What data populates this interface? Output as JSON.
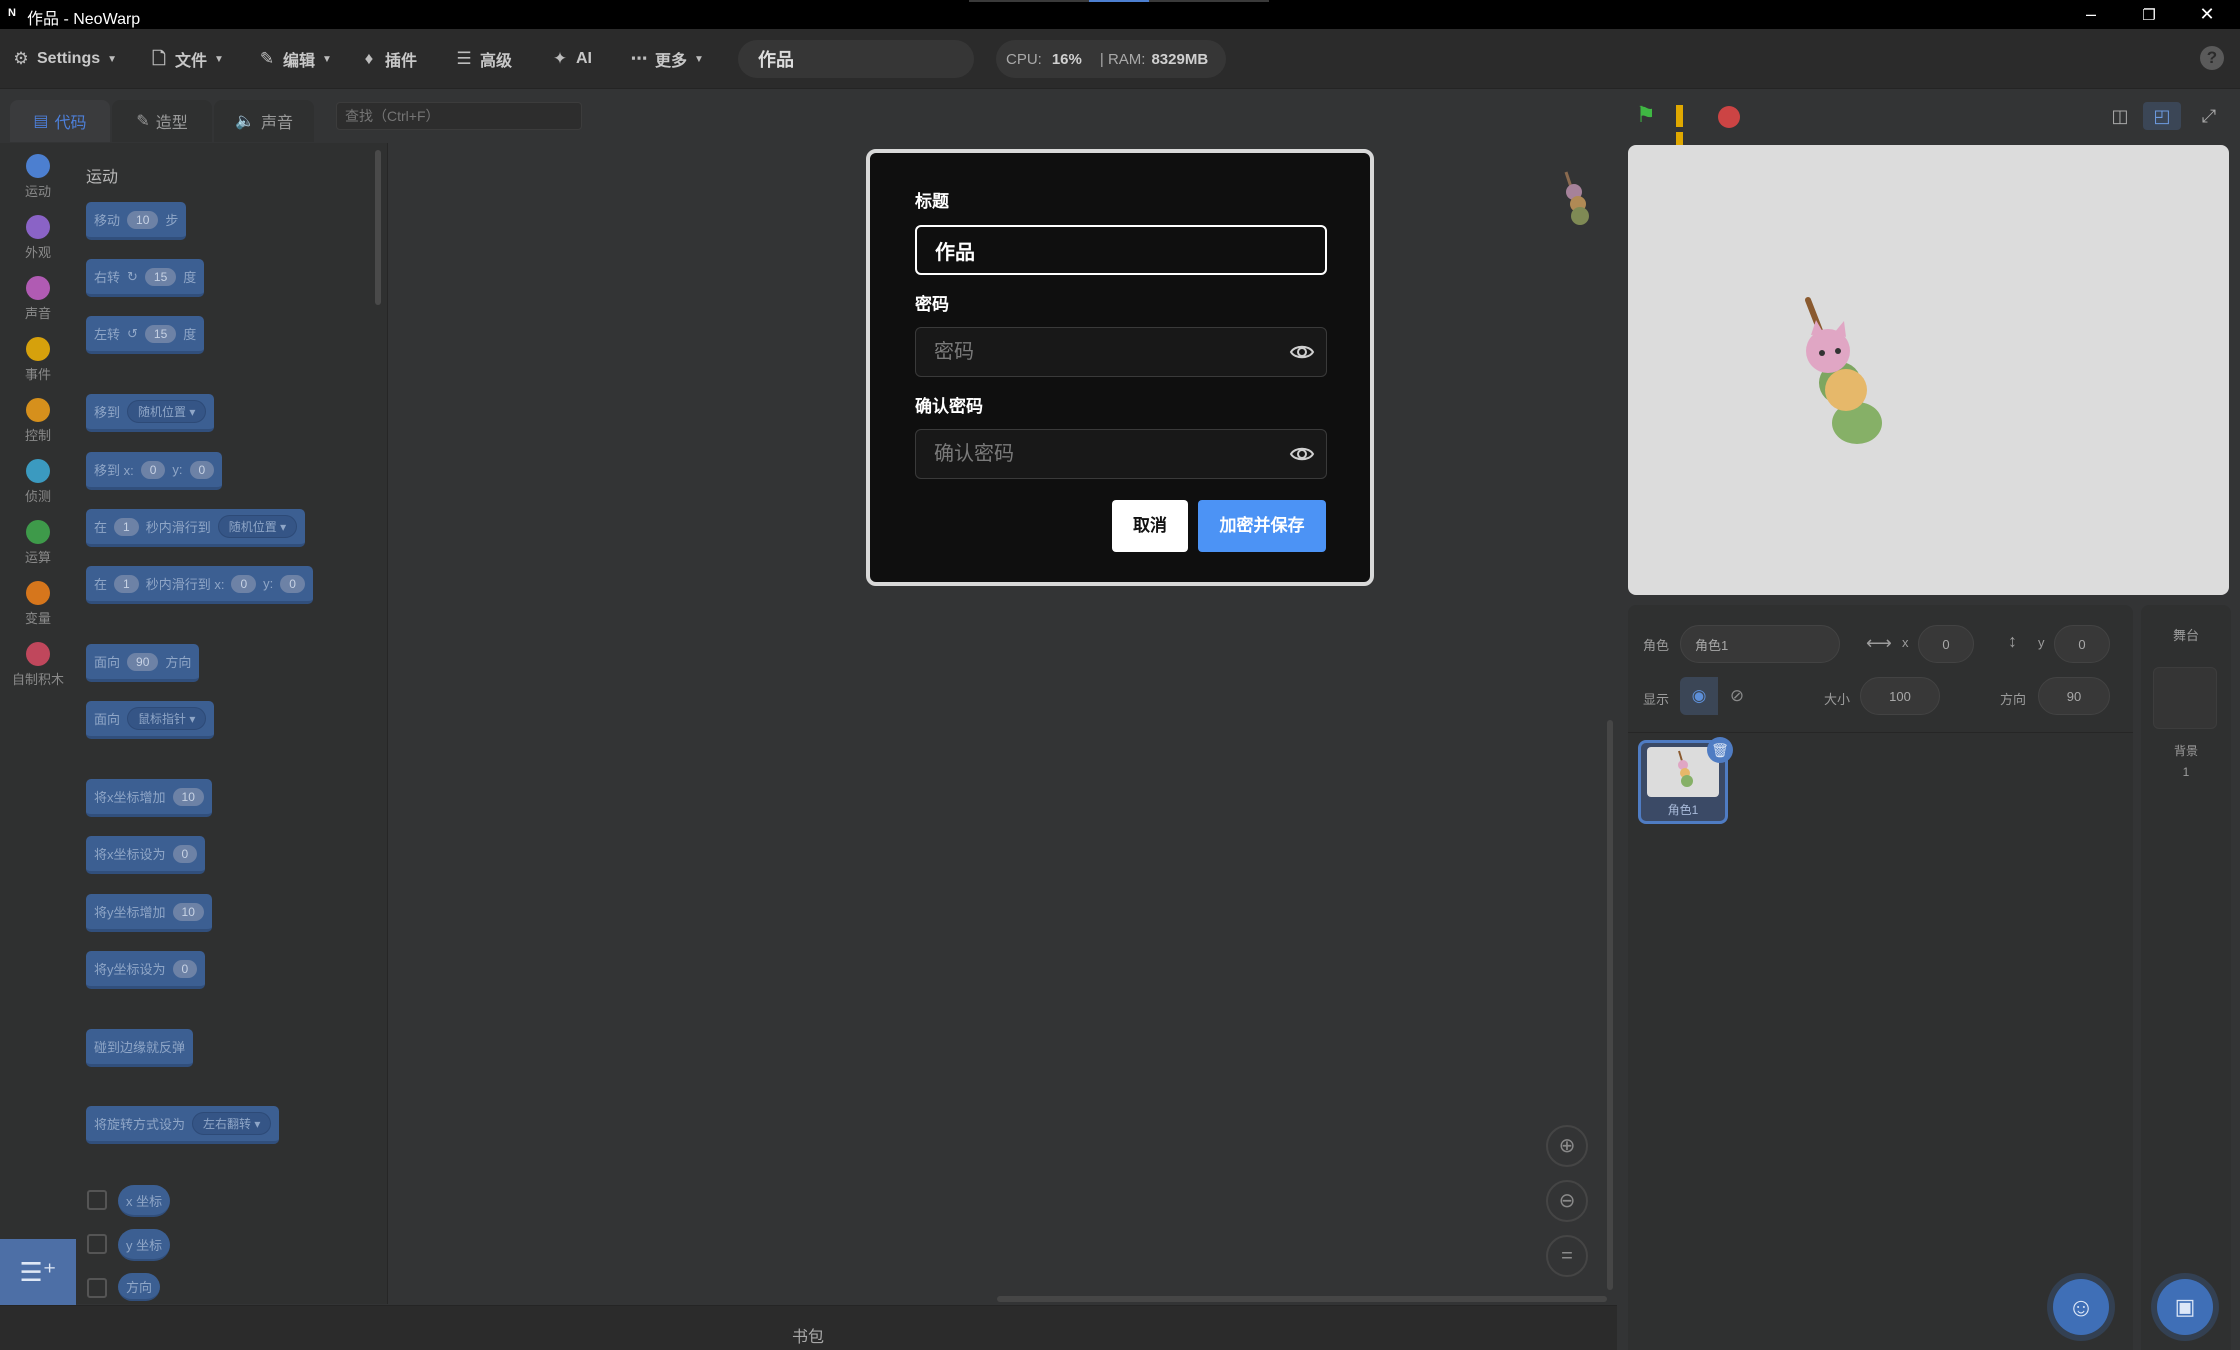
{
  "window": {
    "title": "作品 - NeoWarp",
    "logo": "N",
    "controls": [
      "minimize-icon",
      "restore-icon",
      "close-icon"
    ]
  },
  "menubar": {
    "settings": "Settings",
    "file": "文件",
    "edit": "编辑",
    "addons": "插件",
    "advanced": "高级",
    "ai": "AI",
    "more": "更多",
    "project_title": "作品",
    "cpu_label": "CPU:",
    "cpu_value": "16%",
    "ram_label": "| RAM:",
    "ram_value": "8329MB",
    "help": "?"
  },
  "tabs": {
    "code": "代码",
    "costumes": "造型",
    "sounds": "声音"
  },
  "search": {
    "placeholder": "查找（Ctrl+F）"
  },
  "categories": [
    {
      "label": "运动",
      "color": "#4c7fd0"
    },
    {
      "label": "外观",
      "color": "#8a63c6"
    },
    {
      "label": "声音",
      "color": "#b05bb3"
    },
    {
      "label": "事件",
      "color": "#d6a10c"
    },
    {
      "label": "控制",
      "color": "#d6901c"
    },
    {
      "label": "侦测",
      "color": "#3b9ac0"
    },
    {
      "label": "运算",
      "color": "#3e9a4a"
    },
    {
      "label": "变量",
      "color": "#d6761c"
    },
    {
      "label": "自制积木",
      "color": "#c0475c"
    }
  ],
  "palette": {
    "section": "运动",
    "blocks": {
      "move": {
        "a": "移动",
        "v": "10",
        "b": "步"
      },
      "turn_right": {
        "a": "右转",
        "v": "15",
        "b": "度"
      },
      "turn_left": {
        "a": "左转",
        "v": "15",
        "b": "度"
      },
      "goto": {
        "a": "移到",
        "d": "随机位置"
      },
      "goto_xy": {
        "a": "移到 x:",
        "x": "0",
        "b": "y:",
        "y": "0"
      },
      "glide": {
        "a": "在",
        "v": "1",
        "b": "秒内滑行到",
        "d": "随机位置"
      },
      "glide_xy": {
        "a": "在",
        "v": "1",
        "b": "秒内滑行到 x:",
        "x": "0",
        "c": "y:",
        "y": "0"
      },
      "point_dir": {
        "a": "面向",
        "v": "90",
        "b": "方向"
      },
      "point_towards": {
        "a": "面向",
        "d": "鼠标指针"
      },
      "change_x": {
        "a": "将x坐标增加",
        "v": "10"
      },
      "set_x": {
        "a": "将x坐标设为",
        "v": "0"
      },
      "change_y": {
        "a": "将y坐标增加",
        "v": "10"
      },
      "set_y": {
        "a": "将y坐标设为",
        "v": "0"
      },
      "bounce": {
        "a": "碰到边缘就反弹"
      },
      "rotation_style": {
        "a": "将旋转方式设为",
        "d": "左右翻转"
      },
      "rep_x": "x 坐标",
      "rep_y": "y 坐标",
      "rep_dir": "方向"
    }
  },
  "code_area": {
    "backpack": "书包"
  },
  "sprite_info": {
    "sprite_label": "角色",
    "sprite_name": "角色1",
    "x_label": "x",
    "x": "0",
    "y_label": "y",
    "y": "0",
    "show_label": "显示",
    "size_label": "大小",
    "size": "100",
    "direction_label": "方向",
    "direction": "90"
  },
  "sprites": [
    {
      "name": "角色1",
      "selected": true
    }
  ],
  "stage_panel": {
    "header": "舞台",
    "backdrops_label": "背景",
    "backdrops_count": "1"
  },
  "modal": {
    "title_label": "标题",
    "title_value": "作品",
    "password_label": "密码",
    "password_placeholder": "密码",
    "confirm_label": "确认密码",
    "confirm_placeholder": "确认密码",
    "cancel": "取消",
    "save": "加密并保存"
  }
}
